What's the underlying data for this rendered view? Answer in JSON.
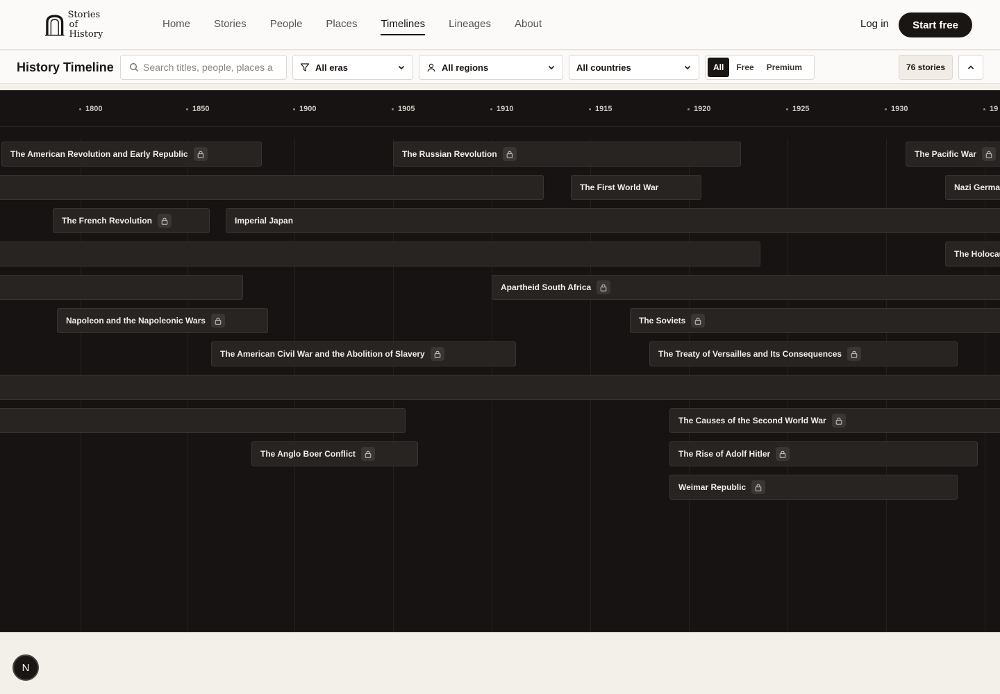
{
  "brand": {
    "line1": "Stories",
    "line2": "of History"
  },
  "nav": [
    {
      "label": "Home",
      "active": false
    },
    {
      "label": "Stories",
      "active": false
    },
    {
      "label": "People",
      "active": false
    },
    {
      "label": "Places",
      "active": false
    },
    {
      "label": "Timelines",
      "active": true
    },
    {
      "label": "Lineages",
      "active": false
    },
    {
      "label": "About",
      "active": false
    }
  ],
  "auth": {
    "login_label": "Log in",
    "start_label": "Start free"
  },
  "filters": {
    "title": "History Timeline",
    "search_placeholder": "Search titles, people, places a",
    "eras": "All eras",
    "regions": "All regions",
    "countries": "All countries",
    "access": [
      "All",
      "Free",
      "Premium"
    ],
    "access_selected": "All",
    "count": "76 stories"
  },
  "timeline": {
    "ticks": [
      "1800",
      "1850",
      "1900",
      "1905",
      "1910",
      "1915",
      "1920",
      "1925",
      "1930",
      "19"
    ],
    "bars": [
      {
        "label": "The American Revolution and Early Republic",
        "locked": true
      },
      {
        "label": "The Russian Revolution",
        "locked": true
      },
      {
        "label": "The Pacific War",
        "locked": true
      },
      {
        "label": "",
        "locked": false
      },
      {
        "label": "The First World War",
        "locked": false
      },
      {
        "label": "Nazi Germa",
        "locked": false
      },
      {
        "label": "The French Revolution",
        "locked": true
      },
      {
        "label": "Imperial Japan",
        "locked": false
      },
      {
        "label": "",
        "locked": false
      },
      {
        "label": "The Holocau",
        "locked": false
      },
      {
        "label": "",
        "locked": false
      },
      {
        "label": "Apartheid South Africa",
        "locked": true
      },
      {
        "label": "Napoleon and the Napoleonic Wars",
        "locked": true
      },
      {
        "label": "The Soviets",
        "locked": true
      },
      {
        "label": "The American Civil War and the Abolition of Slavery",
        "locked": true
      },
      {
        "label": "The Treaty of Versailles and Its Consequences",
        "locked": true
      },
      {
        "label": "",
        "locked": false
      },
      {
        "label": "",
        "locked": false
      },
      {
        "label": "The Causes of the Second World War",
        "locked": true
      },
      {
        "label": "The Anglo Boer Conflict",
        "locked": true
      },
      {
        "label": "The Rise of Adolf Hitler",
        "locked": true
      },
      {
        "label": "Weimar Republic",
        "locked": true
      }
    ]
  },
  "corner_button": "N"
}
